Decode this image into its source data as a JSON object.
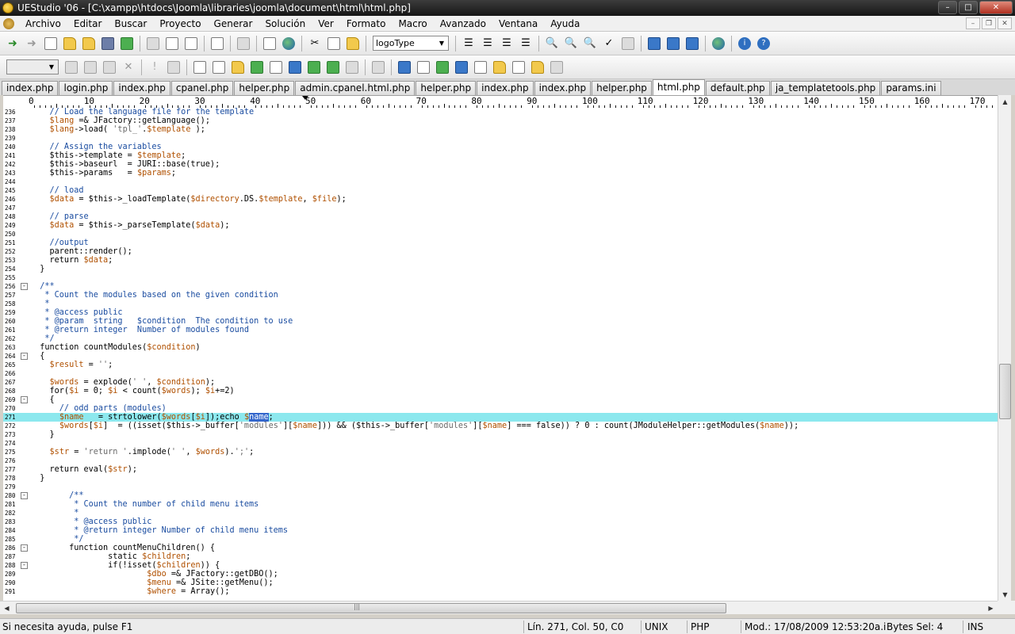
{
  "window": {
    "title": "UEStudio '06 - [C:\\xampp\\htdocs\\Joomla\\libraries\\joomla\\document\\html\\html.php]",
    "controls": [
      "–",
      "□",
      "✕"
    ]
  },
  "menu": {
    "items": [
      "Archivo",
      "Editar",
      "Buscar",
      "Proyecto",
      "Generar",
      "Solución",
      "Ver",
      "Formato",
      "Macro",
      "Avanzado",
      "Ventana",
      "Ayuda"
    ],
    "mdi_controls": [
      "–",
      "❐",
      "✕"
    ]
  },
  "toolbar": {
    "style_combo": "logoType"
  },
  "tabs": [
    "index.php",
    "login.php",
    "index.php",
    "cpanel.php",
    "helper.php",
    "admin.cpanel.html.php",
    "helper.php",
    "index.php",
    "index.php",
    "helper.php",
    "html.php",
    "default.php",
    "ja_templatetools.php",
    "params.ini"
  ],
  "active_tab": 10,
  "ruler": {
    "labels": [
      "0",
      "10",
      "20",
      "30",
      "40",
      "50",
      "60",
      "70",
      "80",
      "90",
      "100",
      "110",
      "120",
      "130",
      "140",
      "150",
      "160",
      "170"
    ],
    "caret_column": 50
  },
  "editor": {
    "current_line": 271,
    "lines": [
      {
        "n": "236",
        "code": "    // Load the language file for the template"
      },
      {
        "n": "237",
        "code": "    $lang =& JFactory::getLanguage();"
      },
      {
        "n": "238",
        "code": "    $lang->load( 'tpl_'.$template );"
      },
      {
        "n": "239",
        "code": ""
      },
      {
        "n": "240",
        "code": "    // Assign the variables"
      },
      {
        "n": "241",
        "code": "    $this->template = $template;"
      },
      {
        "n": "242",
        "code": "    $this->baseurl  = JURI::base(true);"
      },
      {
        "n": "243",
        "code": "    $this->params   = $params;"
      },
      {
        "n": "244",
        "code": ""
      },
      {
        "n": "245",
        "code": "    // load"
      },
      {
        "n": "246",
        "code": "    $data = $this->_loadTemplate($directory.DS.$template, $file);"
      },
      {
        "n": "247",
        "code": ""
      },
      {
        "n": "248",
        "code": "    // parse"
      },
      {
        "n": "249",
        "code": "    $data = $this->_parseTemplate($data);"
      },
      {
        "n": "250",
        "code": ""
      },
      {
        "n": "251",
        "code": "    //output"
      },
      {
        "n": "252",
        "code": "    parent::render();"
      },
      {
        "n": "253",
        "code": "    return $data;"
      },
      {
        "n": "254",
        "code": "  }"
      },
      {
        "n": "255",
        "code": ""
      },
      {
        "n": "256",
        "code": "  /**",
        "fold": "-"
      },
      {
        "n": "257",
        "code": "   * Count the modules based on the given condition"
      },
      {
        "n": "258",
        "code": "   *"
      },
      {
        "n": "259",
        "code": "   * @access public"
      },
      {
        "n": "260",
        "code": "   * @param  string   $condition  The condition to use"
      },
      {
        "n": "261",
        "code": "   * @return integer  Number of modules found"
      },
      {
        "n": "262",
        "code": "   */"
      },
      {
        "n": "263",
        "code": "  function countModules($condition)"
      },
      {
        "n": "264",
        "code": "  {",
        "fold": "-"
      },
      {
        "n": "265",
        "code": "    $result = '';"
      },
      {
        "n": "266",
        "code": ""
      },
      {
        "n": "267",
        "code": "    $words = explode(' ', $condition);"
      },
      {
        "n": "268",
        "code": "    for($i = 0; $i < count($words); $i+=2)"
      },
      {
        "n": "269",
        "code": "    {",
        "fold": "-"
      },
      {
        "n": "270",
        "code": "      // odd parts (modules)"
      },
      {
        "n": "271",
        "code": "      $name   = strtolower($words[$i]);echo $name;"
      },
      {
        "n": "272",
        "code": "      $words[$i]  = ((isset($this->_buffer['modules'][$name])) && ($this->_buffer['modules'][$name] === false)) ? 0 : count(JModuleHelper::getModules($name));"
      },
      {
        "n": "273",
        "code": "    }"
      },
      {
        "n": "274",
        "code": ""
      },
      {
        "n": "275",
        "code": "    $str = 'return '.implode(' ', $words).';';"
      },
      {
        "n": "276",
        "code": ""
      },
      {
        "n": "277",
        "code": "    return eval($str);"
      },
      {
        "n": "278",
        "code": "  }"
      },
      {
        "n": "279",
        "code": ""
      },
      {
        "n": "280",
        "code": "        /**",
        "fold": "-"
      },
      {
        "n": "281",
        "code": "         * Count the number of child menu items"
      },
      {
        "n": "282",
        "code": "         *"
      },
      {
        "n": "283",
        "code": "         * @access public"
      },
      {
        "n": "284",
        "code": "         * @return integer Number of child menu items"
      },
      {
        "n": "285",
        "code": "         */"
      },
      {
        "n": "286",
        "code": "        function countMenuChildren() {",
        "fold": "-"
      },
      {
        "n": "287",
        "code": "                static $children;"
      },
      {
        "n": "288",
        "code": "                if(!isset($children)) {",
        "fold": "-"
      },
      {
        "n": "289",
        "code": "                        $dbo =& JFactory::getDBO();"
      },
      {
        "n": "290",
        "code": "                        $menu =& JSite::getMenu();"
      },
      {
        "n": "291",
        "code": "                        $where = Array();"
      }
    ]
  },
  "status": {
    "help": "Si necesita ayuda, pulse F1",
    "position": "Lín. 271, Col. 50, C0",
    "line_ending": "UNIX",
    "language": "PHP",
    "modified": "Mod.: 17/08/2009 12:53:20a.i",
    "bytes_sel": "Bytes Sel: 4",
    "ins": "INS"
  }
}
